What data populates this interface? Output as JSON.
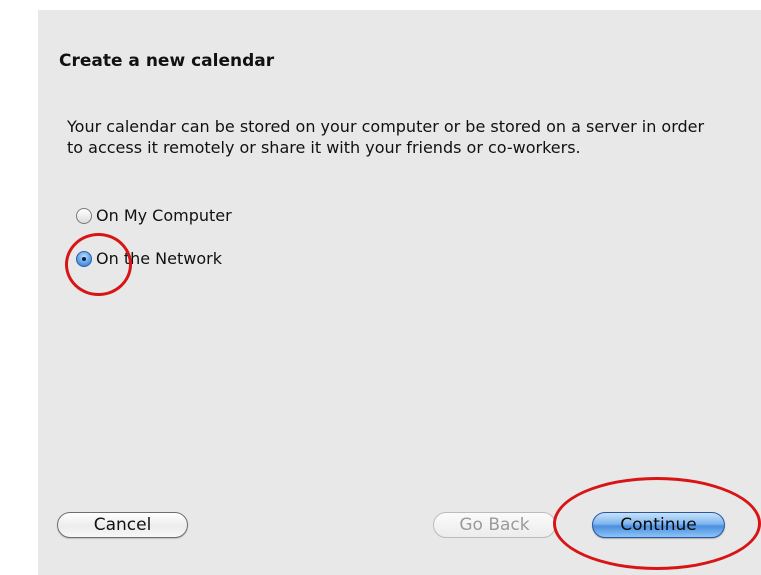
{
  "dialog": {
    "title": "Create a new calendar",
    "description": "Your calendar can be stored on your computer or be stored on a server in order to access it remotely or share it with your friends or co-workers.",
    "options": [
      {
        "label": "On My Computer",
        "selected": false
      },
      {
        "label": "On the Network",
        "selected": true
      }
    ],
    "buttons": {
      "cancel": "Cancel",
      "go_back": "Go Back",
      "continue": "Continue"
    }
  },
  "colors": {
    "annotation": "#d81414",
    "accent": "#4c8ee0",
    "dialog_background": "#e8e8e8"
  }
}
